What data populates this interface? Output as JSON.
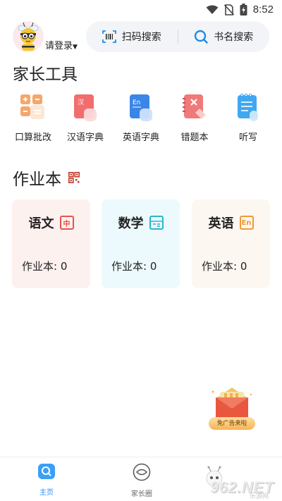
{
  "status_bar": {
    "time": "8:52",
    "icons": [
      "wifi-icon",
      "no-sim-icon",
      "battery-charging-icon"
    ]
  },
  "header": {
    "login_label": "请登录",
    "scan_search_label": "扫码搜索",
    "book_search_label": "书名搜索"
  },
  "parent_tools": {
    "title": "家长工具",
    "items": [
      {
        "label": "口算批改",
        "icon": "calculator-icon",
        "color": "#f5a66c"
      },
      {
        "label": "汉语字典",
        "icon": "chinese-dictionary-icon",
        "badge": "汉",
        "color": "#f26d6d"
      },
      {
        "label": "英语字典",
        "icon": "english-dictionary-icon",
        "badge": "En",
        "color": "#3a86e8"
      },
      {
        "label": "错题本",
        "icon": "mistake-notebook-icon",
        "color": "#f07a7a"
      },
      {
        "label": "听写",
        "icon": "dictation-notepad-icon",
        "color": "#3fa8f0"
      }
    ]
  },
  "homework": {
    "title": "作业本",
    "books": [
      {
        "subject": "语文",
        "badge": "中",
        "count_text": "作业本: 0",
        "bg": "#fdf1ef",
        "accent": "#e8534a"
      },
      {
        "subject": "数学",
        "badge": "",
        "count_text": "作业本: 0",
        "bg": "#edfafd",
        "accent": "#2bb6cc"
      },
      {
        "subject": "英语",
        "badge": "En",
        "count_text": "作业本: 0",
        "bg": "#fdf7f1",
        "accent": "#ee9a37"
      }
    ]
  },
  "ad": {
    "label": "免广告来啦"
  },
  "bottom_nav": {
    "items": [
      {
        "label": "主页",
        "active": true,
        "color": "#2c8bf5"
      },
      {
        "label": "家长圈",
        "active": false,
        "color": "#666666"
      }
    ]
  },
  "watermark": {
    "brand": "962.NET",
    "subtitle": "乐游网"
  }
}
